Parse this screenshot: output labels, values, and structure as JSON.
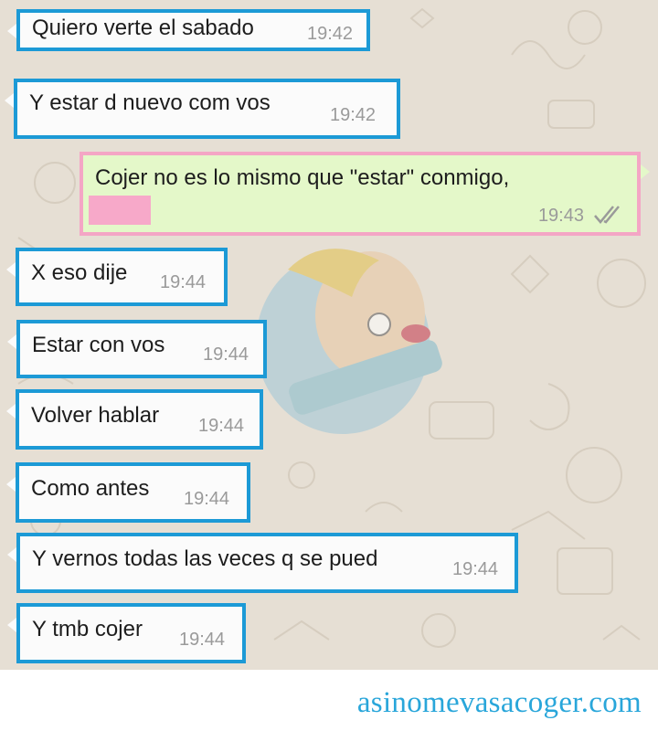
{
  "messages_incoming": [
    {
      "text": "Quiero verte el sabado",
      "time": "19:42"
    },
    {
      "text": "Y estar d nuevo com vos",
      "time": "19:42"
    },
    {
      "text": "X eso dije",
      "time": "19:44"
    },
    {
      "text": "Estar con vos",
      "time": "19:44"
    },
    {
      "text": "Volver hablar",
      "time": "19:44"
    },
    {
      "text": "Como antes",
      "time": "19:44"
    },
    {
      "text": "Y vernos todas las veces q se pued",
      "time": "19:44"
    },
    {
      "text": "Y tmb cojer",
      "time": "19:44"
    }
  ],
  "message_outgoing": {
    "text": "Cojer no es lo mismo que \"estar\" conmigo,",
    "time": "19:43",
    "status_icon": "double-check-icon"
  },
  "footer": {
    "site": "asinomevasacoger.com"
  },
  "colors": {
    "incoming_border": "#1c9ad6",
    "outgoing_border": "#f4a6c5",
    "outgoing_bg": "#e4f8c9",
    "chat_bg": "#e6dfd4",
    "footer_text": "#29a6da"
  }
}
